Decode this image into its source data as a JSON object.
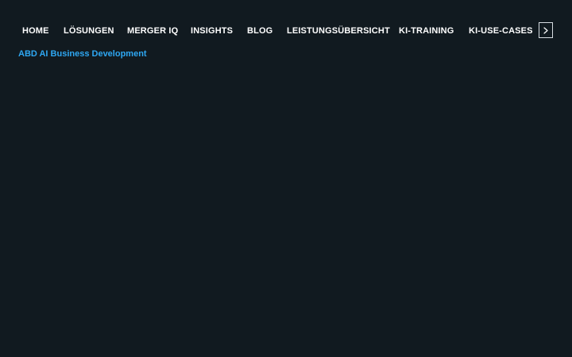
{
  "nav": {
    "items": [
      {
        "label": "HOME"
      },
      {
        "label": "LÖSUNGEN"
      },
      {
        "label": "MERGER IQ"
      },
      {
        "label": "INSIGHTS"
      },
      {
        "label": "BLOG"
      },
      {
        "label": "LEISTUNGSÜBERSICHT"
      },
      {
        "label": "KI-TRAINING"
      },
      {
        "label": "KI-USE-CASES"
      }
    ],
    "next_icon": "chevron-right-icon"
  },
  "brand": {
    "title": "ABD AI Business Development"
  },
  "colors": {
    "background": "#111a20",
    "nav_text": "#ffffff",
    "brand_text": "#2ea7f2",
    "button_border": "#d7dde2"
  }
}
